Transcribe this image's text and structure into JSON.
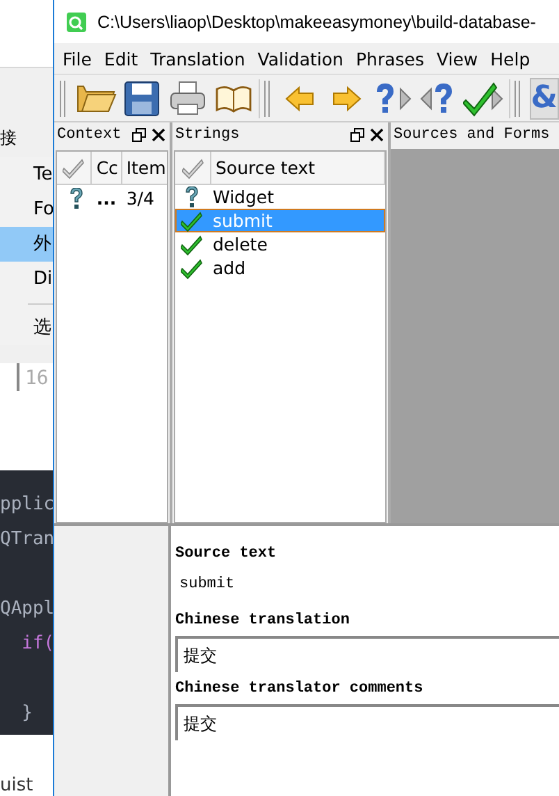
{
  "background_window": {
    "top_text": "接",
    "menu_items": [
      {
        "label": "Te",
        "selected": false
      },
      {
        "label": "Fo",
        "selected": false
      },
      {
        "label": "外",
        "selected": true
      },
      {
        "label": "Di",
        "selected": false
      },
      {
        "label": "选",
        "selected": false
      }
    ],
    "line_number": "16",
    "code_lines": [
      {
        "text": "pplic",
        "kind": "plain"
      },
      {
        "text": "QTran",
        "kind": "plain"
      },
      {
        "kind": "blank"
      },
      {
        "text": "QAppl",
        "kind": "plain"
      },
      {
        "text": "  if(",
        "kind": "keyword"
      },
      {
        "kind": "blank"
      },
      {
        "text": "  }",
        "kind": "plain"
      }
    ],
    "bottom_text": "uist"
  },
  "window": {
    "title": "C:\\Users\\liaop\\Desktop\\makeeasymoney\\build-database-"
  },
  "menu": [
    "File",
    "Edit",
    "Translation",
    "Validation",
    "Phrases",
    "View",
    "Help"
  ],
  "toolbar": [
    {
      "kind": "open"
    },
    {
      "kind": "save"
    },
    {
      "kind": "print"
    },
    {
      "kind": "book"
    },
    {
      "kind": "sep"
    },
    {
      "kind": "prev"
    },
    {
      "kind": "next"
    },
    {
      "kind": "prev-unfinished"
    },
    {
      "kind": "next-unfinished"
    },
    {
      "kind": "done-next"
    },
    {
      "kind": "sep"
    },
    {
      "kind": "text",
      "label": "&"
    }
  ],
  "context": {
    "title": "Context",
    "columns": [
      "Cc",
      "Item"
    ],
    "rows": [
      {
        "kind": "unfinished",
        "name": "...",
        "items": "3/4"
      }
    ]
  },
  "strings": {
    "title": "Strings",
    "columns": [
      "Source text"
    ],
    "rows": [
      {
        "kind": "unfinished",
        "text": "Widget",
        "selected": false
      },
      {
        "kind": "done",
        "text": "submit",
        "selected": true
      },
      {
        "kind": "done",
        "text": "delete",
        "selected": false
      },
      {
        "kind": "done",
        "text": "add",
        "selected": false
      }
    ]
  },
  "sources": {
    "title": "Sources and Forms"
  },
  "editor": {
    "source_label": "Source text",
    "source": "submit",
    "fields": [
      {
        "label": "Chinese translation",
        "value": "提交"
      },
      {
        "label": "Chinese translator comments",
        "value": "提交"
      }
    ]
  }
}
